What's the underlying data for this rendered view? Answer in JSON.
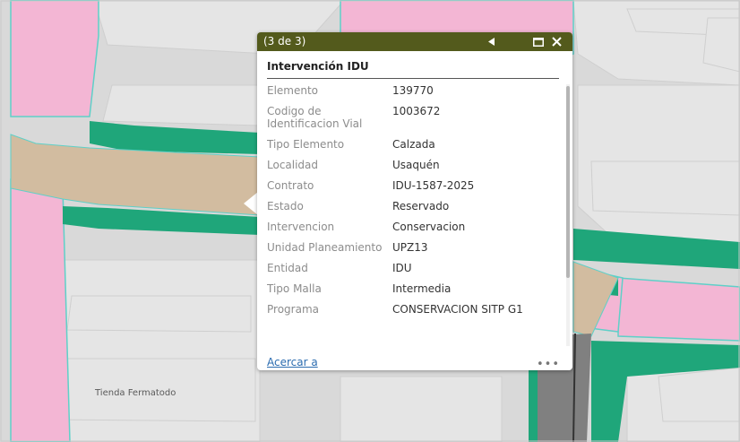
{
  "map": {
    "label": "Tienda Fermatodo",
    "colors": {
      "background": "#d9d9d9",
      "building": "#e4e4e4",
      "pink": "#f3b6d4",
      "road": "#d2bca0",
      "sidewalk": "#1fa67a",
      "asphalt": "#808080"
    }
  },
  "popup": {
    "header": {
      "counter": "(3 de 3)",
      "prev_icon": "triangle-left-icon",
      "maximize_icon": "maximize-icon",
      "close_icon": "close-icon",
      "background": "#535a1c"
    },
    "title": "Intervención IDU",
    "fields": [
      {
        "label": "Elemento",
        "value": "139770"
      },
      {
        "label": "Codigo de Identificacion Vial",
        "value": "1003672"
      },
      {
        "label": "Tipo Elemento",
        "value": "Calzada"
      },
      {
        "label": "Localidad",
        "value": "Usaquén"
      },
      {
        "label": "Contrato",
        "value": "IDU-1587-2025"
      },
      {
        "label": "Estado",
        "value": "Reservado"
      },
      {
        "label": "Intervencion",
        "value": "Conservacion"
      },
      {
        "label": "Unidad Planeamiento",
        "value": "UPZ13"
      },
      {
        "label": "Entidad",
        "value": "IDU"
      },
      {
        "label": "Tipo Malla",
        "value": "Intermedia"
      },
      {
        "label": "Programa",
        "value": "CONSERVACION SITP G1"
      }
    ],
    "footer": {
      "zoom_link": "Acercar a",
      "more": "•••"
    }
  }
}
